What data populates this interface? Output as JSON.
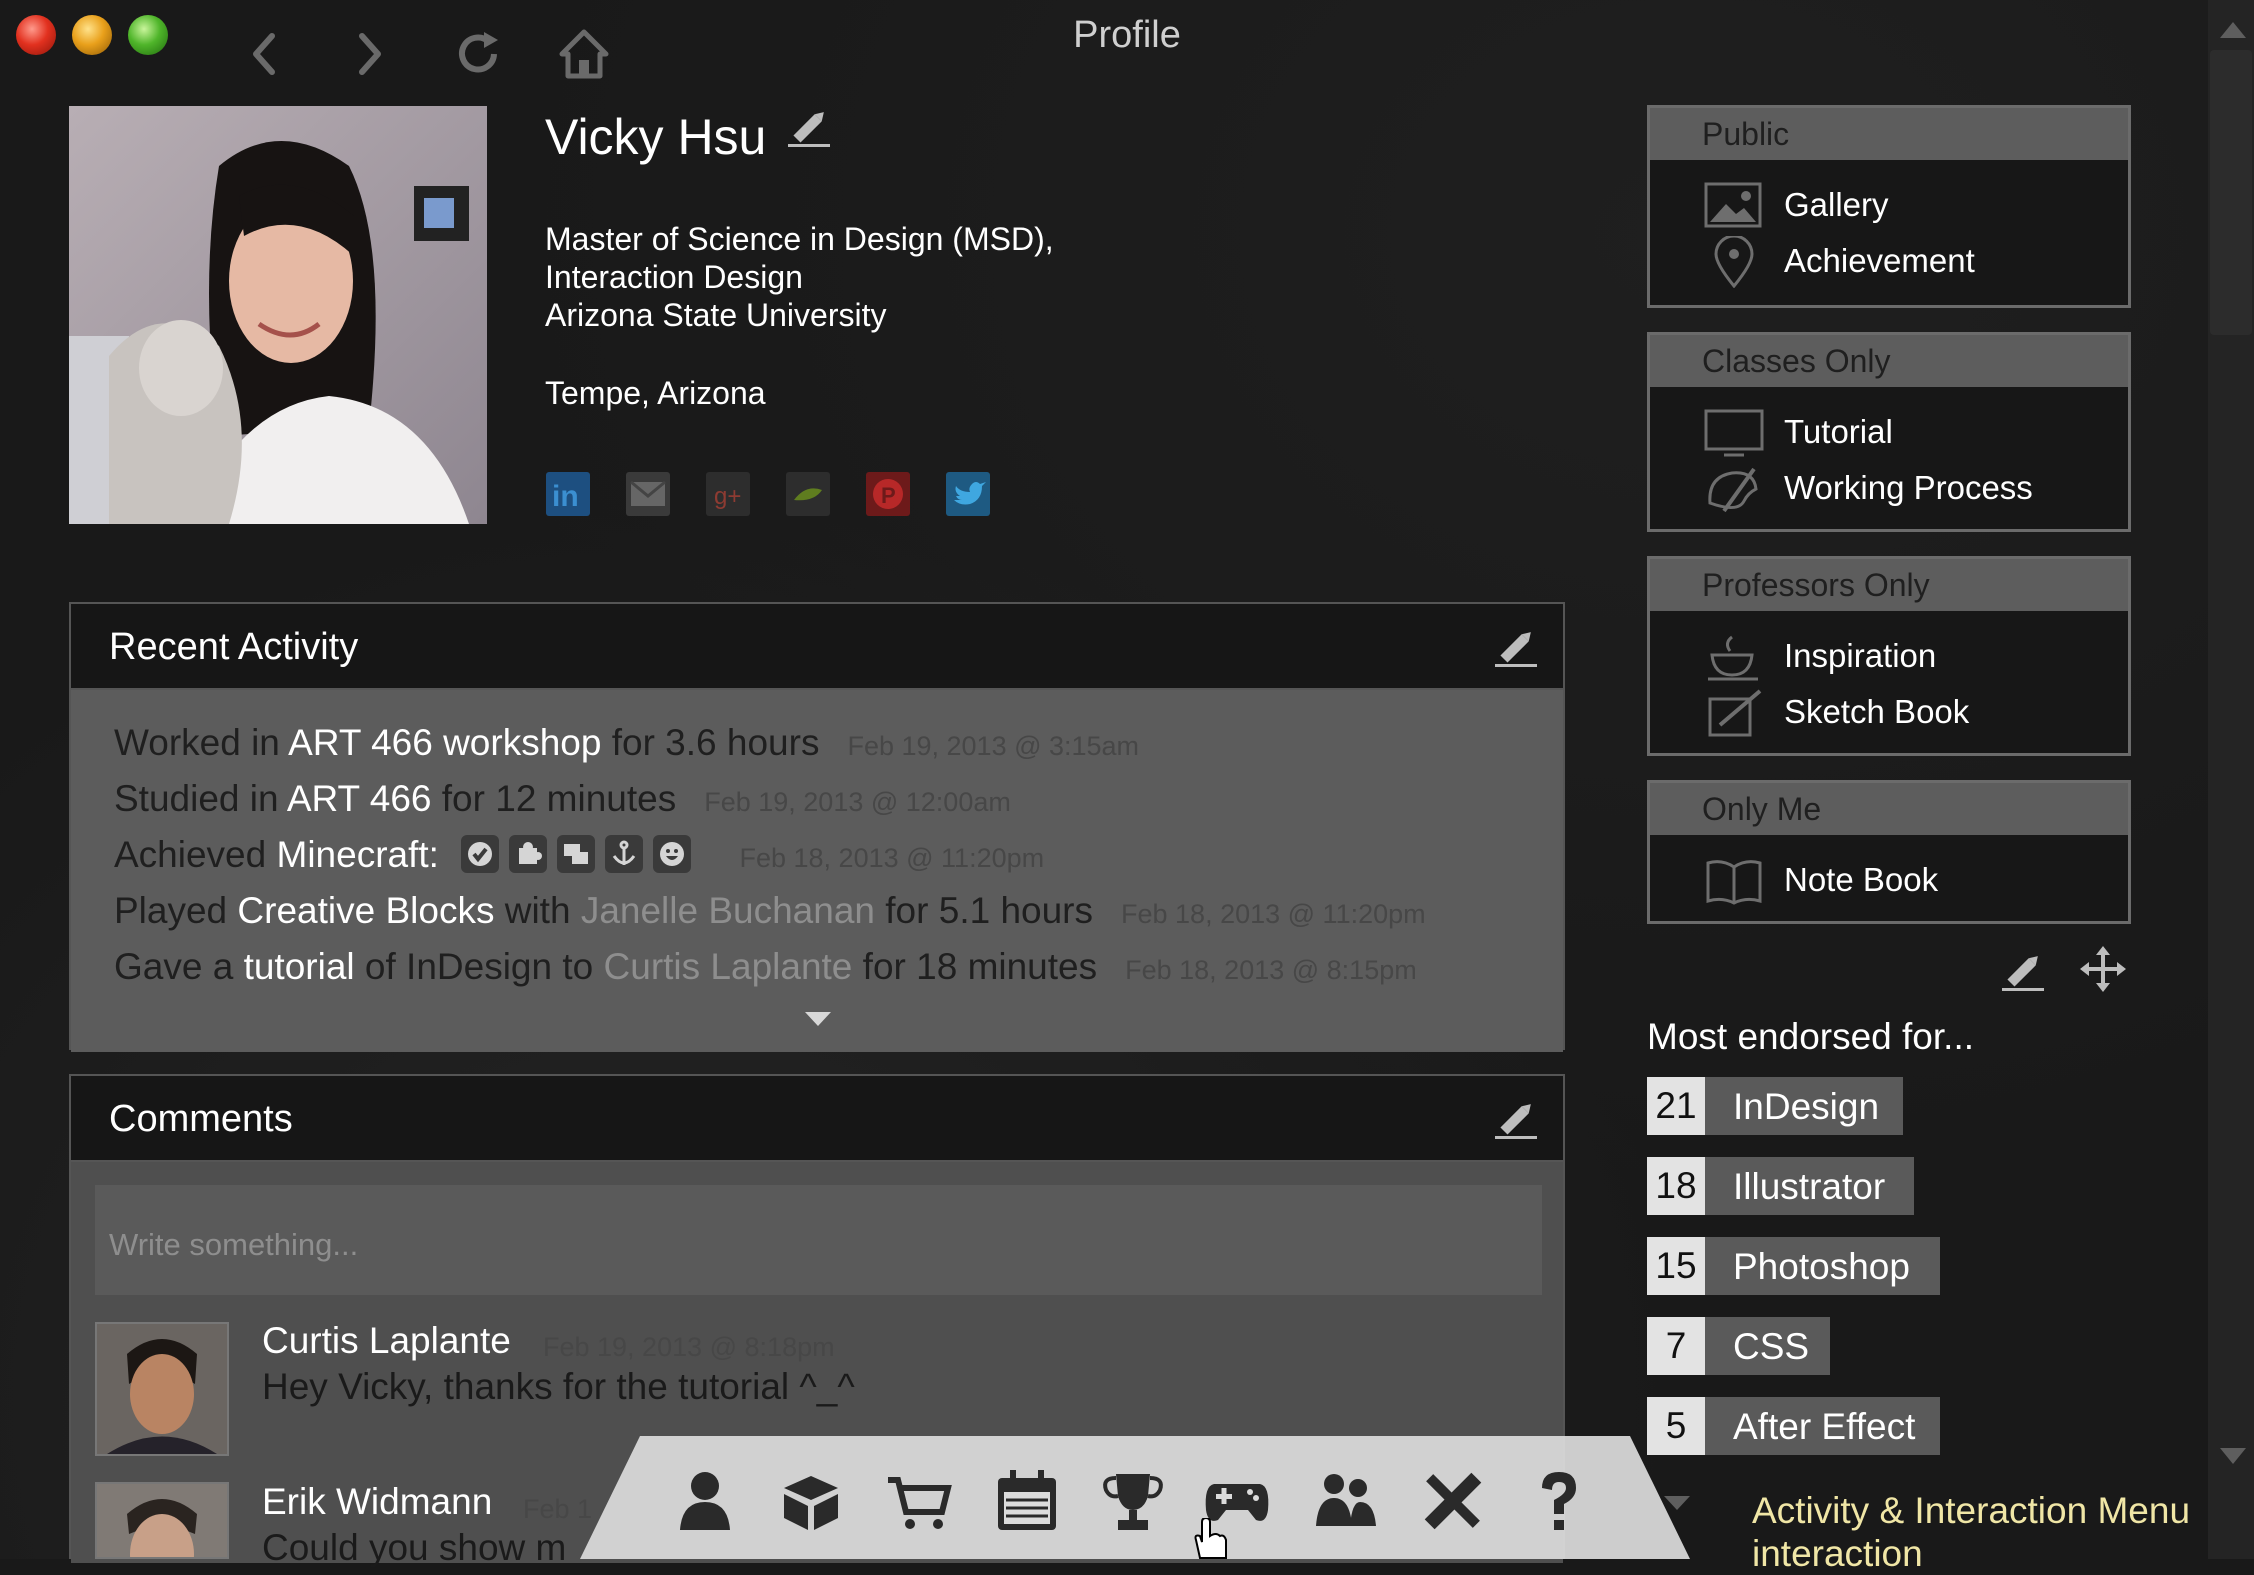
{
  "window": {
    "title": "Profile"
  },
  "profile": {
    "name": "Vicky Hsu",
    "degree_line1": "Master of Science in Design (MSD),",
    "degree_line2": "Interaction Design",
    "university": "Arizona State University",
    "location": "Tempe, Arizona",
    "social": [
      "linkedin-icon",
      "email-icon",
      "google-plus-icon",
      "behance-icon",
      "pinterest-icon",
      "twitter-icon"
    ]
  },
  "recent_activity": {
    "title": "Recent Activity",
    "items": [
      {
        "a": "Worked in ",
        "b": "ART 466 workshop",
        "c": " for 3.6 hours",
        "time": "Feb 19, 2013 @ 3:15am"
      },
      {
        "a": "Studied in ",
        "b": "ART 466",
        "c": " for 12 minutes",
        "time": "Feb 19, 2013 @ 12:00am"
      },
      {
        "a": "Achieved ",
        "b": "Minecraft:",
        "time": "Feb 18, 2013 @ 11:20pm"
      },
      {
        "a": "Played ",
        "b": "Creative Blocks",
        "c": " with ",
        "d": "Janelle Buchanan",
        "e": " for 5.1 hours",
        "time": "Feb 18, 2013 @ 11:20pm"
      },
      {
        "a": "Gave a ",
        "b": "tutorial",
        "c": " of InDesign to ",
        "d": "Curtis Laplante",
        "e": " for 18 minutes",
        "time": "Feb 18, 2013 @ 8:15pm"
      }
    ]
  },
  "comments": {
    "title": "Comments",
    "placeholder": "Write something...",
    "items": [
      {
        "author": "Curtis Laplante",
        "time": "Feb 19, 2013 @ 8:18pm",
        "text": "Hey Vicky, thanks for the tutorial ^_^"
      },
      {
        "author": "Erik Widmann",
        "time": "Feb 1",
        "text": "Could you show m"
      }
    ]
  },
  "sidebar": {
    "public": {
      "title": "Public",
      "items": [
        "Gallery",
        "Achievement"
      ]
    },
    "classes": {
      "title": "Classes Only",
      "items": [
        "Tutorial",
        "Working Process"
      ]
    },
    "professors": {
      "title": "Professors Only",
      "items": [
        "Inspiration",
        "Sketch Book"
      ]
    },
    "only_me": {
      "title": "Only Me",
      "items": [
        "Note Book"
      ]
    }
  },
  "endorsements": {
    "title": "Most endorsed for...",
    "items": [
      {
        "count": "21",
        "skill": "InDesign"
      },
      {
        "count": "18",
        "skill": "Illustrator"
      },
      {
        "count": "15",
        "skill": "Photoshop"
      },
      {
        "count": "7",
        "skill": "CSS"
      },
      {
        "count": "5",
        "skill": "After Effect"
      }
    ]
  },
  "dock": {
    "icons": [
      "profile-icon",
      "box-icon",
      "cart-icon",
      "calendar-icon",
      "trophy-icon",
      "gamepad-icon",
      "people-icon",
      "tools-icon",
      "help-icon"
    ],
    "label_line1": "Activity & Interaction Menu",
    "label_line2": "interaction"
  },
  "colors": {
    "accent_note": "#f0e6a6",
    "panel_body": "#5c5c5c",
    "background": "#191919"
  }
}
